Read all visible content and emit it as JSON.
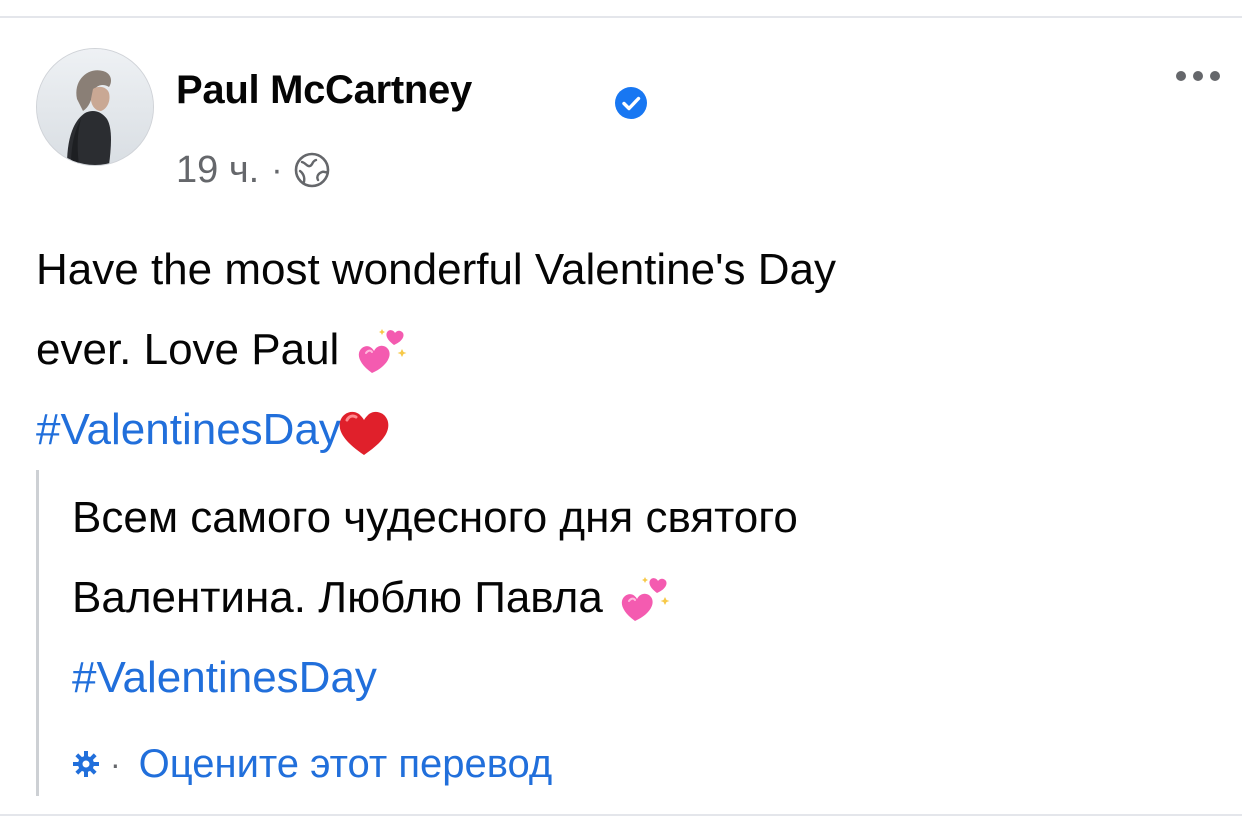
{
  "post": {
    "author": "Paul McCartney",
    "timestamp": "19 ч.",
    "separator": "·",
    "text_line1": "Have the most wonderful Valentine's Day",
    "text_line2": "ever.  Love Paul",
    "hashtag": "#ValentinesDay",
    "emoji": {
      "sparkling_hearts": "sparkling-hearts",
      "red_heart": "red-heart"
    }
  },
  "translation": {
    "line1": "Всем самого чудесного дня святого",
    "line2": "Валентина. Люблю Павла",
    "hashtag": "#ValentinesDay",
    "rate_separator": "·",
    "rate_label": "Оцените этот перевод"
  },
  "colors": {
    "link": "#216fdb",
    "muted": "#65676b",
    "verified": "#1877f2",
    "heart_pink": "#f45bb0",
    "heart_red": "#e0202b"
  },
  "icons": [
    "verified-badge-icon",
    "globe-icon",
    "more-options-icon",
    "gear-icon"
  ]
}
